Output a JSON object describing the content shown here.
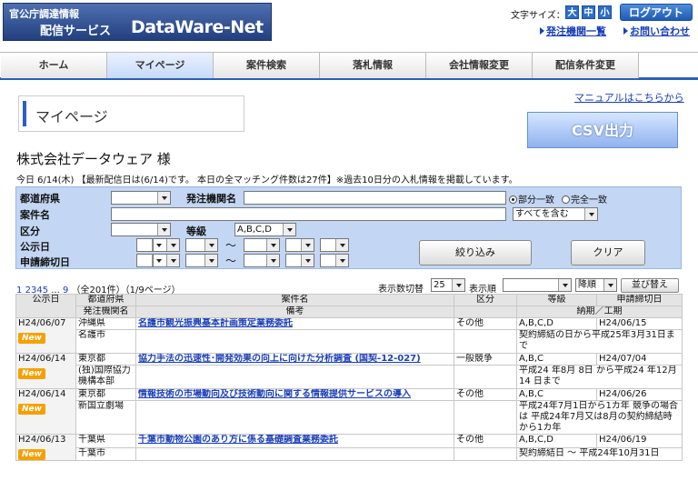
{
  "logo": {
    "line1": "官公庁調達情報",
    "line2": "配信サービス",
    "brand": "DataWare-Net"
  },
  "header": {
    "font_size_label": "文字サイズ：",
    "font_sizes": [
      "大",
      "中",
      "小"
    ],
    "logout": "ログアウト",
    "link1": "発注機関一覧",
    "link2": "お問い合わせ"
  },
  "nav": [
    "ホーム",
    "マイページ",
    "案件検索",
    "落札情報",
    "会社情報変更",
    "配信条件変更"
  ],
  "manual_link": "マニュアルはこちらから",
  "page_title": "マイページ",
  "csv_button": "CSV出力",
  "company": "株式会社データウェア 様",
  "info": "今日 6/14(木) 【最新配信日は(6/14)です。 本日の全マッチング件数は27件】※過去10日分の入札情報を掲載しています。",
  "search": {
    "pref_label": "都道府県",
    "org_label": "発注機関名",
    "radio_partial": "部分一致",
    "radio_exact": "完全一致",
    "case_label": "案件名",
    "case_mode": "すべてを含む",
    "category_label": "区分",
    "grade_label": "等級",
    "grade_value": "A,B,C,D",
    "pub_label": "公示日",
    "deadline_label": "申請締切日",
    "tilde": "〜",
    "filter_button": "絞り込み",
    "clear_button": "クリア"
  },
  "pager": {
    "pages": [
      "1",
      "2",
      "3",
      "4",
      "5",
      "...",
      "9"
    ],
    "summary": "（全201件）（1/9ページ）"
  },
  "controls": {
    "per_page_label": "表示数切替",
    "per_page": "25",
    "order_label": "表示順",
    "order_dir": "降順",
    "sort_button": "並び替え"
  },
  "table": {
    "headers": {
      "pub": "公示日",
      "pref": "都道府県",
      "org": "発注機関名",
      "title": "案件名",
      "remarks": "備考",
      "cat": "区分",
      "grade": "等級",
      "deadline": "申請締切日",
      "period": "納期／工期"
    },
    "new_badge": "New",
    "rows": [
      {
        "date": "H24/06/07",
        "pref": "沖縄県",
        "org": "名護市",
        "title": "名護市観光振興基本計画策定業務委託",
        "cat": "その他",
        "grade": "A,B,C,D",
        "deadline": "H24/06/15",
        "period": "契約締結の日から平成25年3月31日まで"
      },
      {
        "date": "H24/06/14",
        "pref": "東京都",
        "org": "(独)国際協力機構本部",
        "title": "協力手法の迅速性･開発効果の向上に向けた分析調査 (国契-12-027)",
        "cat": "一般競争",
        "grade": "A,B,C",
        "deadline": "H24/07/04",
        "period": "平成24 年8月 8日 から平成24 年12月14 日まで"
      },
      {
        "date": "H24/06/14",
        "pref": "東京都",
        "org": "新国立劇場",
        "title": "情報技術の市場動向及び技術動向に関する情報提供サービスの導入",
        "cat": "その他",
        "grade": "A,B,C",
        "deadline": "H24/06/26",
        "period": "平成24年7月1日から1カ年 競争の場合は 平成24年7月又は8月の契約締結時から1カ年"
      },
      {
        "date": "H24/06/13",
        "pref": "千葉県",
        "org": "千葉市",
        "title": "千葉市動物公園のあり方に係る基礎調査業務委託",
        "cat": "その他",
        "grade": "A,B,C,D",
        "deadline": "H24/06/19",
        "period": "契約締結日 〜 平成24年10月31日"
      }
    ]
  }
}
